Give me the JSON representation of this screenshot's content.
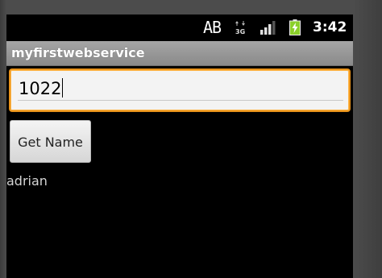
{
  "status_bar": {
    "keyboard_indicator": "AB",
    "network_icon": "3g-data-icon",
    "signal_icon": "signal-strength-icon",
    "battery_icon": "battery-charging-icon",
    "time": "3:42"
  },
  "app": {
    "title": "myfirstwebservice"
  },
  "form": {
    "input_value": "1022",
    "button_label": "Get Name",
    "result_text": "adrian"
  },
  "colors": {
    "focus_border": "#e8931b",
    "title_bar": "#9a9a9a",
    "battery_accent": "#8bd02a"
  }
}
